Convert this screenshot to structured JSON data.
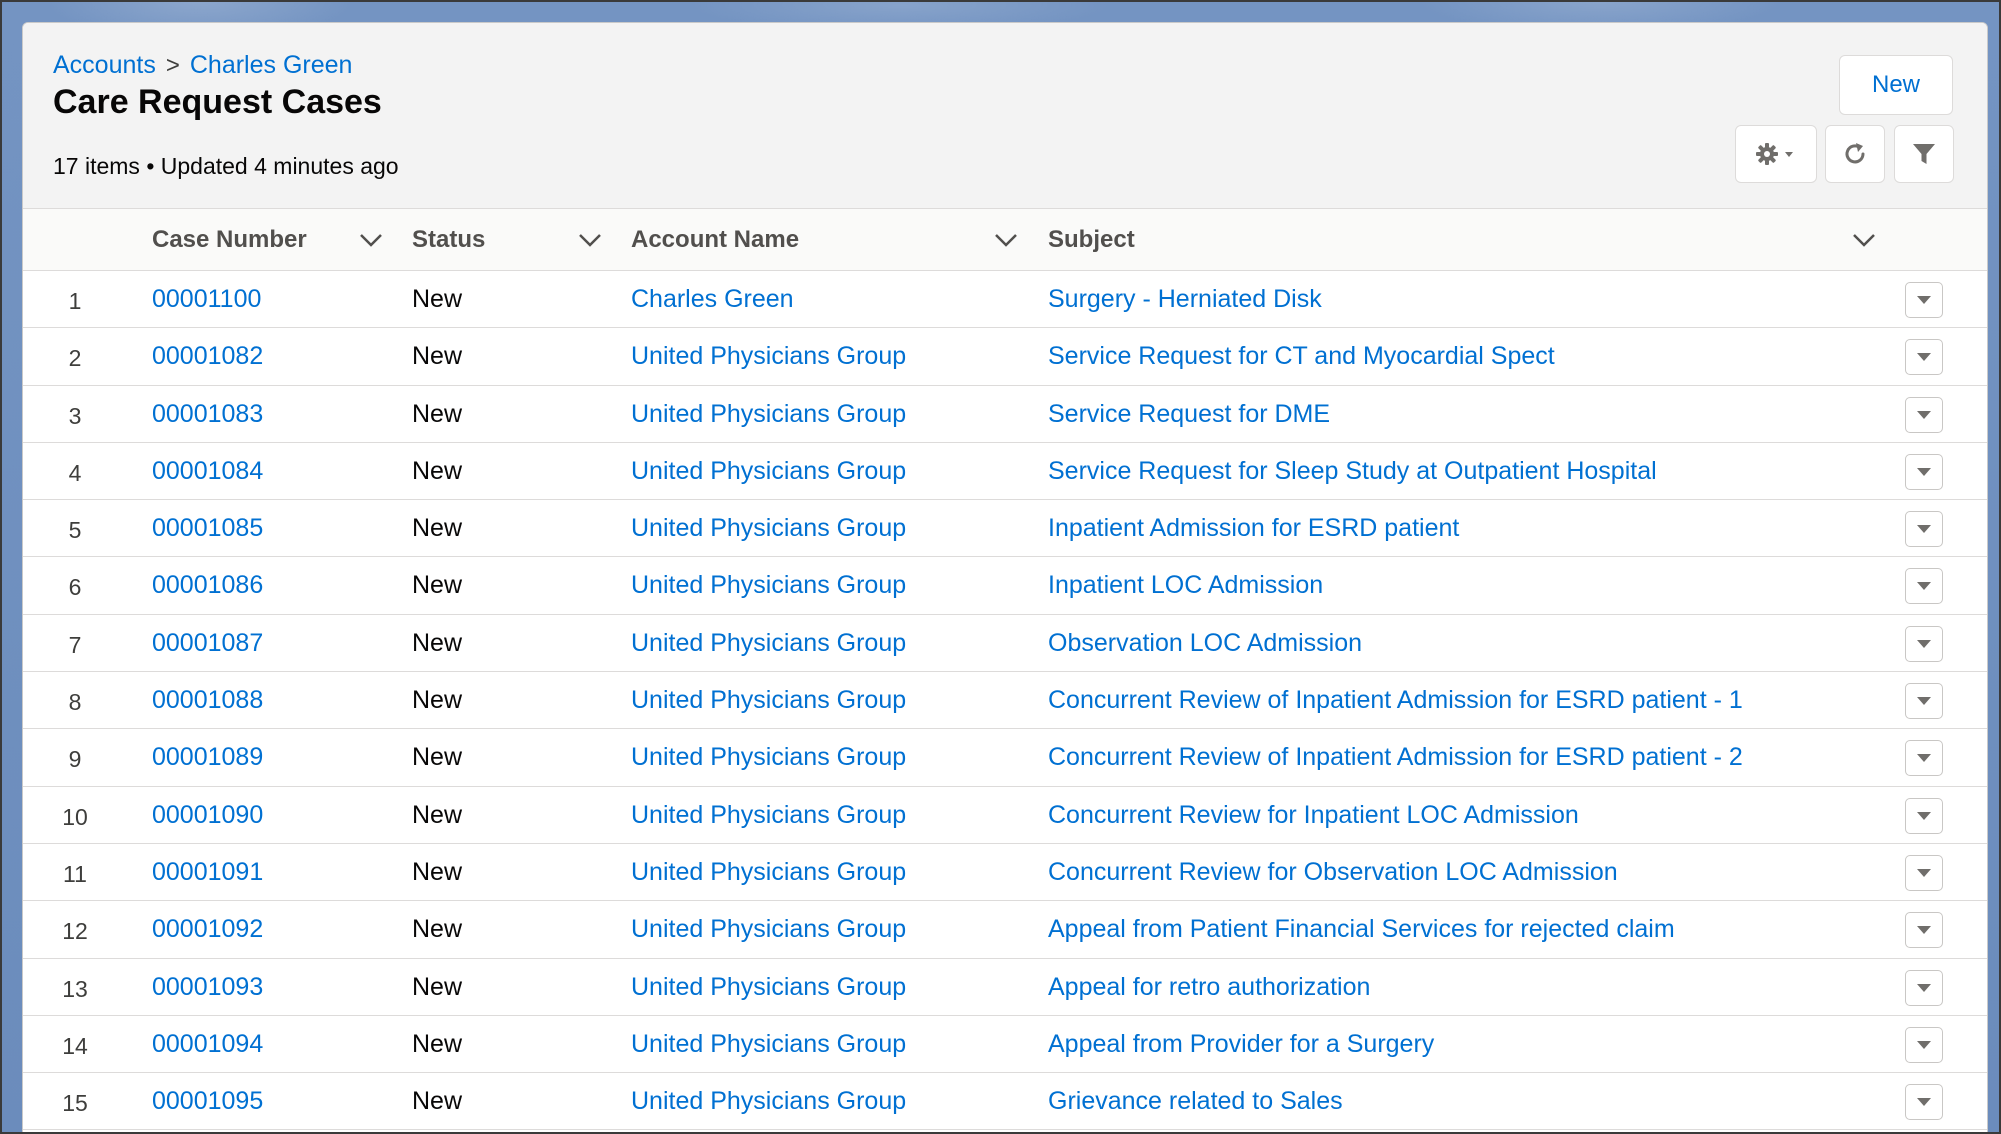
{
  "breadcrumb": {
    "parent": "Accounts",
    "separator": ">",
    "current": "Charles Green"
  },
  "page_title": "Care Request Cases",
  "meta": "17 items • Updated 4 minutes ago",
  "toolbar": {
    "new_label": "New",
    "settings_icon": "gear-icon",
    "refresh_icon": "refresh-icon",
    "filter_icon": "filter-icon"
  },
  "columns": [
    "Case Number",
    "Status",
    "Account Name",
    "Subject"
  ],
  "rows": [
    {
      "num": "1",
      "case": "00001100",
      "status": "New",
      "account": "Charles Green",
      "subject": "Surgery - Herniated Disk"
    },
    {
      "num": "2",
      "case": "00001082",
      "status": "New",
      "account": "United Physicians Group",
      "subject": "Service Request for CT and Myocardial Spect"
    },
    {
      "num": "3",
      "case": "00001083",
      "status": "New",
      "account": "United Physicians Group",
      "subject": "Service Request for DME"
    },
    {
      "num": "4",
      "case": "00001084",
      "status": "New",
      "account": "United Physicians Group",
      "subject": "Service Request for Sleep Study at Outpatient Hospital"
    },
    {
      "num": "5",
      "case": "00001085",
      "status": "New",
      "account": "United Physicians Group",
      "subject": "Inpatient Admission for ESRD patient"
    },
    {
      "num": "6",
      "case": "00001086",
      "status": "New",
      "account": "United Physicians Group",
      "subject": "Inpatient LOC Admission"
    },
    {
      "num": "7",
      "case": "00001087",
      "status": "New",
      "account": "United Physicians Group",
      "subject": "Observation LOC Admission"
    },
    {
      "num": "8",
      "case": "00001088",
      "status": "New",
      "account": "United Physicians Group",
      "subject": "Concurrent Review of Inpatient Admission for ESRD patient - 1"
    },
    {
      "num": "9",
      "case": "00001089",
      "status": "New",
      "account": "United Physicians Group",
      "subject": "Concurrent Review of Inpatient Admission for ESRD patient - 2"
    },
    {
      "num": "10",
      "case": "00001090",
      "status": "New",
      "account": "United Physicians Group",
      "subject": "Concurrent Review for Inpatient LOC Admission"
    },
    {
      "num": "11",
      "case": "00001091",
      "status": "New",
      "account": "United Physicians Group",
      "subject": "Concurrent Review for Observation LOC Admission"
    },
    {
      "num": "12",
      "case": "00001092",
      "status": "New",
      "account": "United Physicians Group",
      "subject": "Appeal from Patient Financial Services for rejected claim"
    },
    {
      "num": "13",
      "case": "00001093",
      "status": "New",
      "account": "United Physicians Group",
      "subject": "Appeal for retro authorization"
    },
    {
      "num": "14",
      "case": "00001094",
      "status": "New",
      "account": "United Physicians Group",
      "subject": "Appeal from Provider for a Surgery"
    },
    {
      "num": "15",
      "case": "00001095",
      "status": "New",
      "account": "United Physicians Group",
      "subject": "Grievance related to Sales"
    }
  ],
  "colors": {
    "link": "#0070d2",
    "header_bg": "#f3f3f3",
    "border": "#dddbda"
  }
}
